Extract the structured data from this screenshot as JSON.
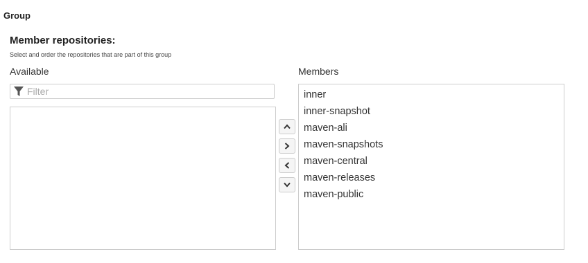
{
  "section": {
    "title": "Group"
  },
  "field": {
    "label": "Member repositories:",
    "help": "Select and order the repositories that are part of this group"
  },
  "available": {
    "label": "Available",
    "filter_placeholder": "Filter",
    "filter_icon": "filter-icon",
    "items": []
  },
  "members": {
    "label": "Members",
    "items": [
      "inner",
      "inner-snapshot",
      "maven-ali",
      "maven-snapshots",
      "maven-central",
      "maven-releases",
      "maven-public"
    ]
  },
  "buttons": {
    "move_up_icon": "chevron-up-icon",
    "add_icon": "chevron-right-icon",
    "remove_icon": "chevron-left-icon",
    "move_down_icon": "chevron-down-icon"
  }
}
